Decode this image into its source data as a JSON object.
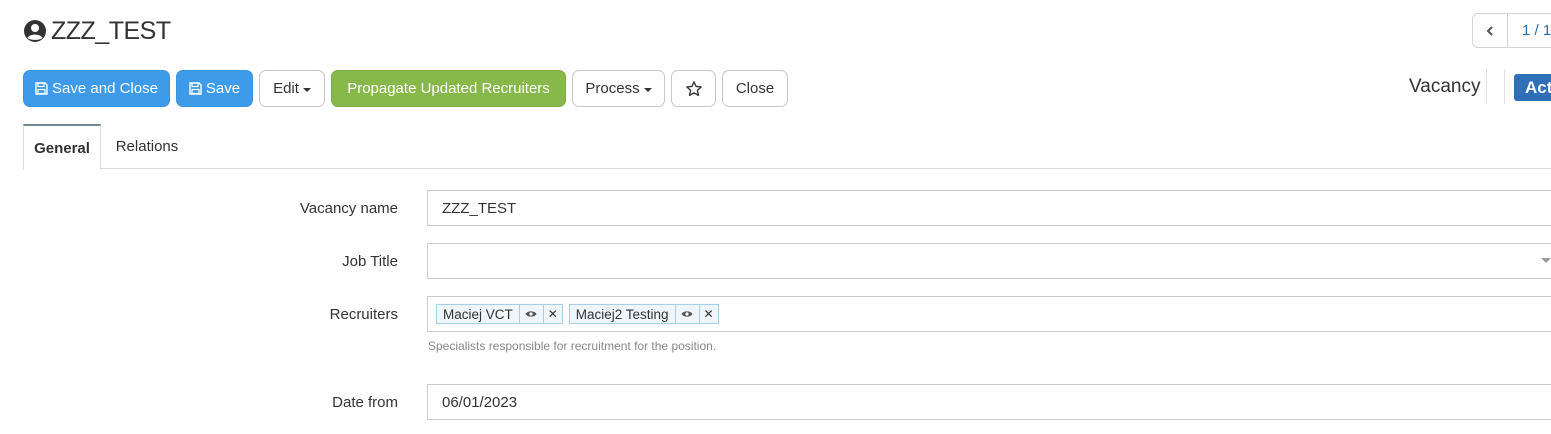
{
  "page": {
    "title": "ZZZ_TEST",
    "title_icon": "user-circle-icon"
  },
  "pager": {
    "prev_icon": "chevron-left-icon",
    "text": "1 / 1"
  },
  "toolbar": {
    "save_and_close": "Save and Close",
    "save": "Save",
    "edit": "Edit",
    "propagate": "Propagate Updated Recruiters",
    "process": "Process",
    "favorite_icon": "star-icon",
    "close": "Close"
  },
  "header_right": {
    "entity_label": "Vacancy",
    "status": "Active",
    "status_visible": "Act"
  },
  "tabs": [
    {
      "label": "General",
      "active": true
    },
    {
      "label": "Relations",
      "active": false
    }
  ],
  "form": {
    "vacancy_name": {
      "label": "Vacancy name",
      "value": "ZZZ_TEST"
    },
    "job_title": {
      "label": "Job Title",
      "value": ""
    },
    "recruiters": {
      "label": "Recruiters",
      "tags": [
        "Maciej VCT",
        "Maciej2 Testing"
      ],
      "help": "Specialists responsible for recruitment for the position."
    },
    "date_from": {
      "label": "Date from",
      "value": "06/01/2023"
    }
  },
  "colors": {
    "primary_blue": "#3d9be9",
    "green": "#86b94a",
    "status_blue": "#2f6fb7"
  }
}
